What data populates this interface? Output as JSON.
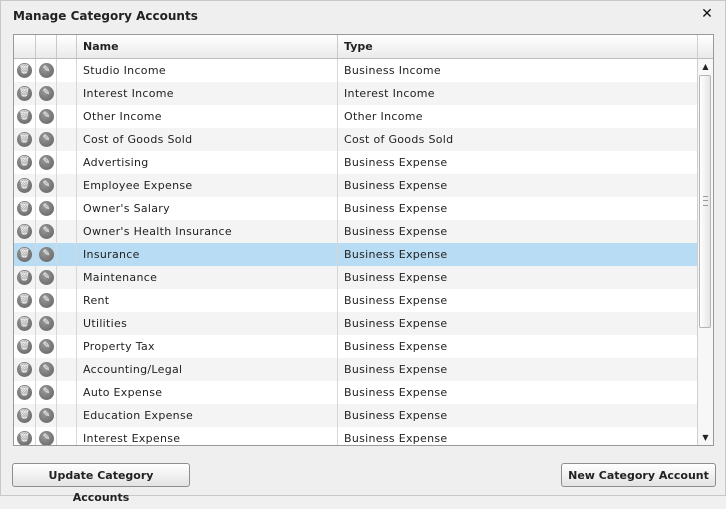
{
  "dialog": {
    "title": "Manage Category Accounts",
    "close_glyph": "✕"
  },
  "table": {
    "headers": {
      "name": "Name",
      "type": "Type"
    },
    "selected_index": 8,
    "rows": [
      {
        "name": "Studio Income",
        "type": "Business Income"
      },
      {
        "name": "Interest Income",
        "type": "Interest Income"
      },
      {
        "name": "Other Income",
        "type": "Other Income"
      },
      {
        "name": "Cost of Goods Sold",
        "type": "Cost of Goods Sold"
      },
      {
        "name": "Advertising",
        "type": "Business Expense"
      },
      {
        "name": "Employee Expense",
        "type": "Business Expense"
      },
      {
        "name": "Owner's Salary",
        "type": "Business Expense"
      },
      {
        "name": "Owner's Health Insurance",
        "type": "Business Expense"
      },
      {
        "name": "Insurance",
        "type": "Business Expense"
      },
      {
        "name": "Maintenance",
        "type": "Business Expense"
      },
      {
        "name": "Rent",
        "type": "Business Expense"
      },
      {
        "name": "Utilities",
        "type": "Business Expense"
      },
      {
        "name": "Property Tax",
        "type": "Business Expense"
      },
      {
        "name": "Accounting/Legal",
        "type": "Business Expense"
      },
      {
        "name": "Auto Expense",
        "type": "Business Expense"
      },
      {
        "name": "Education Expense",
        "type": "Business Expense"
      },
      {
        "name": "Interest Expense",
        "type": "Business Expense"
      }
    ],
    "row_icons": {
      "delete": "trash-icon",
      "edit": "pencil-icon"
    }
  },
  "scrollbar": {
    "up_glyph": "▲",
    "down_glyph": "▼"
  },
  "footer": {
    "update_label": "Update Category Accounts",
    "new_label": "New Category Account"
  }
}
